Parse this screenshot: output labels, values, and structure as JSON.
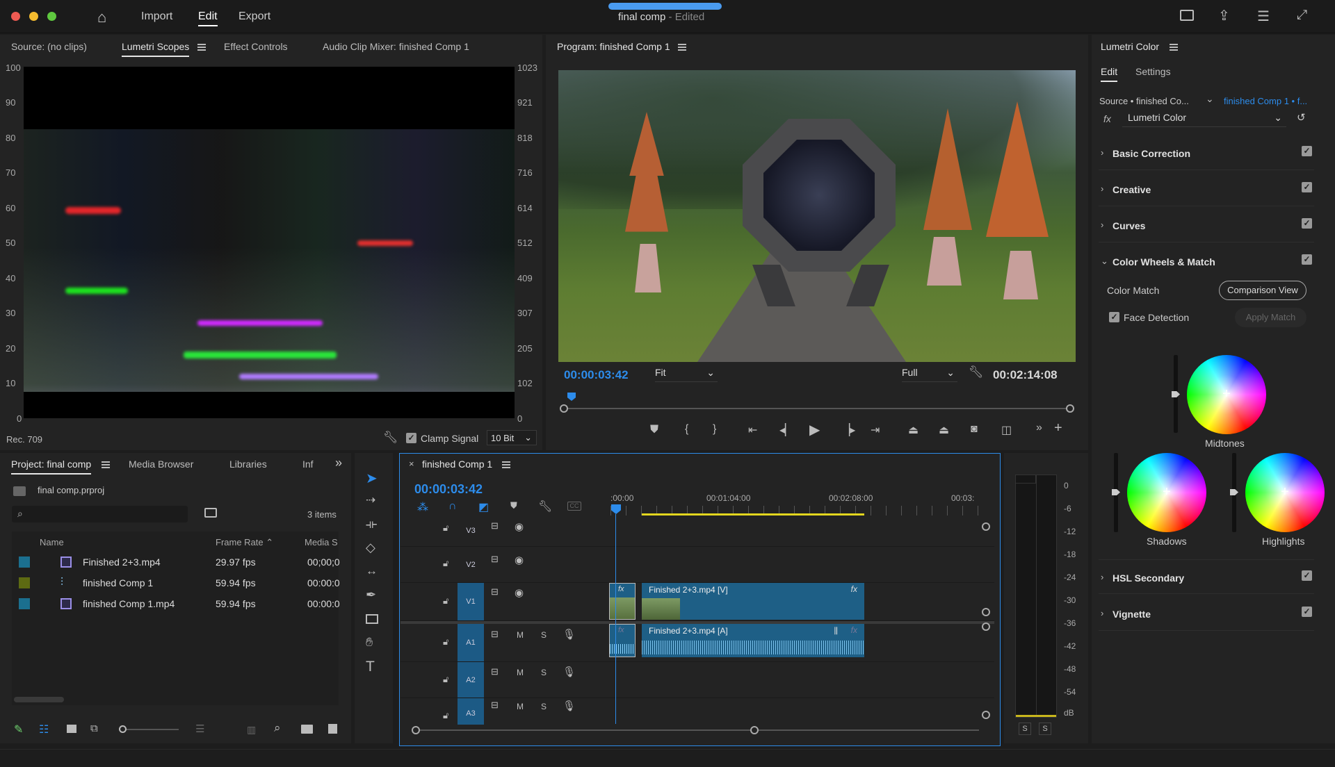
{
  "window": {
    "title": "final comp",
    "title_suffix": " - Edited",
    "nav": {
      "import": "Import",
      "edit": "Edit",
      "export": "Export"
    }
  },
  "source_panel": {
    "tabs": [
      "Source: (no clips)",
      "Lumetri Scopes",
      "Effect Controls",
      "Audio Clip Mixer: finished Comp 1"
    ],
    "scale_left": [
      "100",
      "90",
      "80",
      "70",
      "60",
      "50",
      "40",
      "30",
      "20",
      "10",
      "0"
    ],
    "scale_right": [
      "1023",
      "921",
      "818",
      "716",
      "614",
      "512",
      "409",
      "307",
      "205",
      "102",
      "0"
    ],
    "footer": {
      "rec": "Rec. 709",
      "clamp": "Clamp Signal",
      "bit": "10 Bit"
    }
  },
  "program": {
    "title": "Program: finished Comp 1",
    "timecode": "00:00:03:42",
    "fit": "Fit",
    "quality": "Full",
    "duration": "00:02:14:08"
  },
  "lumetri": {
    "title": "Lumetri Color",
    "tabs": [
      "Edit",
      "Settings"
    ],
    "source": "Source • finished Co...",
    "clip": "finished Comp 1 • f...",
    "fx_label": "fx",
    "effect": "Lumetri Color",
    "sections": [
      "Basic Correction",
      "Creative",
      "Curves",
      "Color Wheels & Match",
      "HSL Secondary",
      "Vignette"
    ],
    "color_match": "Color Match",
    "comparison_view": "Comparison View",
    "face_detection": "Face Detection",
    "apply_match": "Apply Match",
    "wheels": {
      "midtones": "Midtones",
      "shadows": "Shadows",
      "highlights": "Highlights"
    }
  },
  "project": {
    "tabs": [
      "Project: final comp",
      "Media Browser",
      "Libraries",
      "Inf"
    ],
    "file": "final comp.prproj",
    "count": "3 items",
    "columns": [
      "Name",
      "Frame Rate",
      "Media S"
    ],
    "rows": [
      {
        "name": "Finished 2+3.mp4",
        "rate": "29.97 fps",
        "start": "00;00;0",
        "color": "#1b6f8f"
      },
      {
        "name": "finished Comp 1",
        "rate": "59.94 fps",
        "start": "00:00:0",
        "color": "#5d6a12"
      },
      {
        "name": "finished Comp 1.mp4",
        "rate": "59.94 fps",
        "start": "00:00:0",
        "color": "#1b6f8f"
      }
    ]
  },
  "timeline": {
    "tab": "finished Comp 1",
    "timecode": "00:00:03:42",
    "ruler": [
      ":00:00",
      "00:01:04:00",
      "00:02:08:00",
      "00:03:"
    ],
    "tracks": [
      "V3",
      "V2",
      "V1",
      "A1",
      "A2",
      "A3"
    ],
    "track_btn": {
      "mute": "M",
      "solo": "S"
    },
    "clips": {
      "video": "Finished 2+3.mp4 [V]",
      "audio": "Finished 2+3.mp4 [A]",
      "fx": "fx"
    }
  },
  "meter": {
    "scale": [
      "0",
      "-6",
      "-12",
      "-18",
      "-24",
      "-30",
      "-36",
      "-42",
      "-48",
      "-54",
      "dB"
    ],
    "solo": [
      "S",
      "S"
    ]
  },
  "colors": {
    "accent": "#2d8ceb",
    "clip": "#1e5f86",
    "track_blue": "#1c5a85"
  }
}
